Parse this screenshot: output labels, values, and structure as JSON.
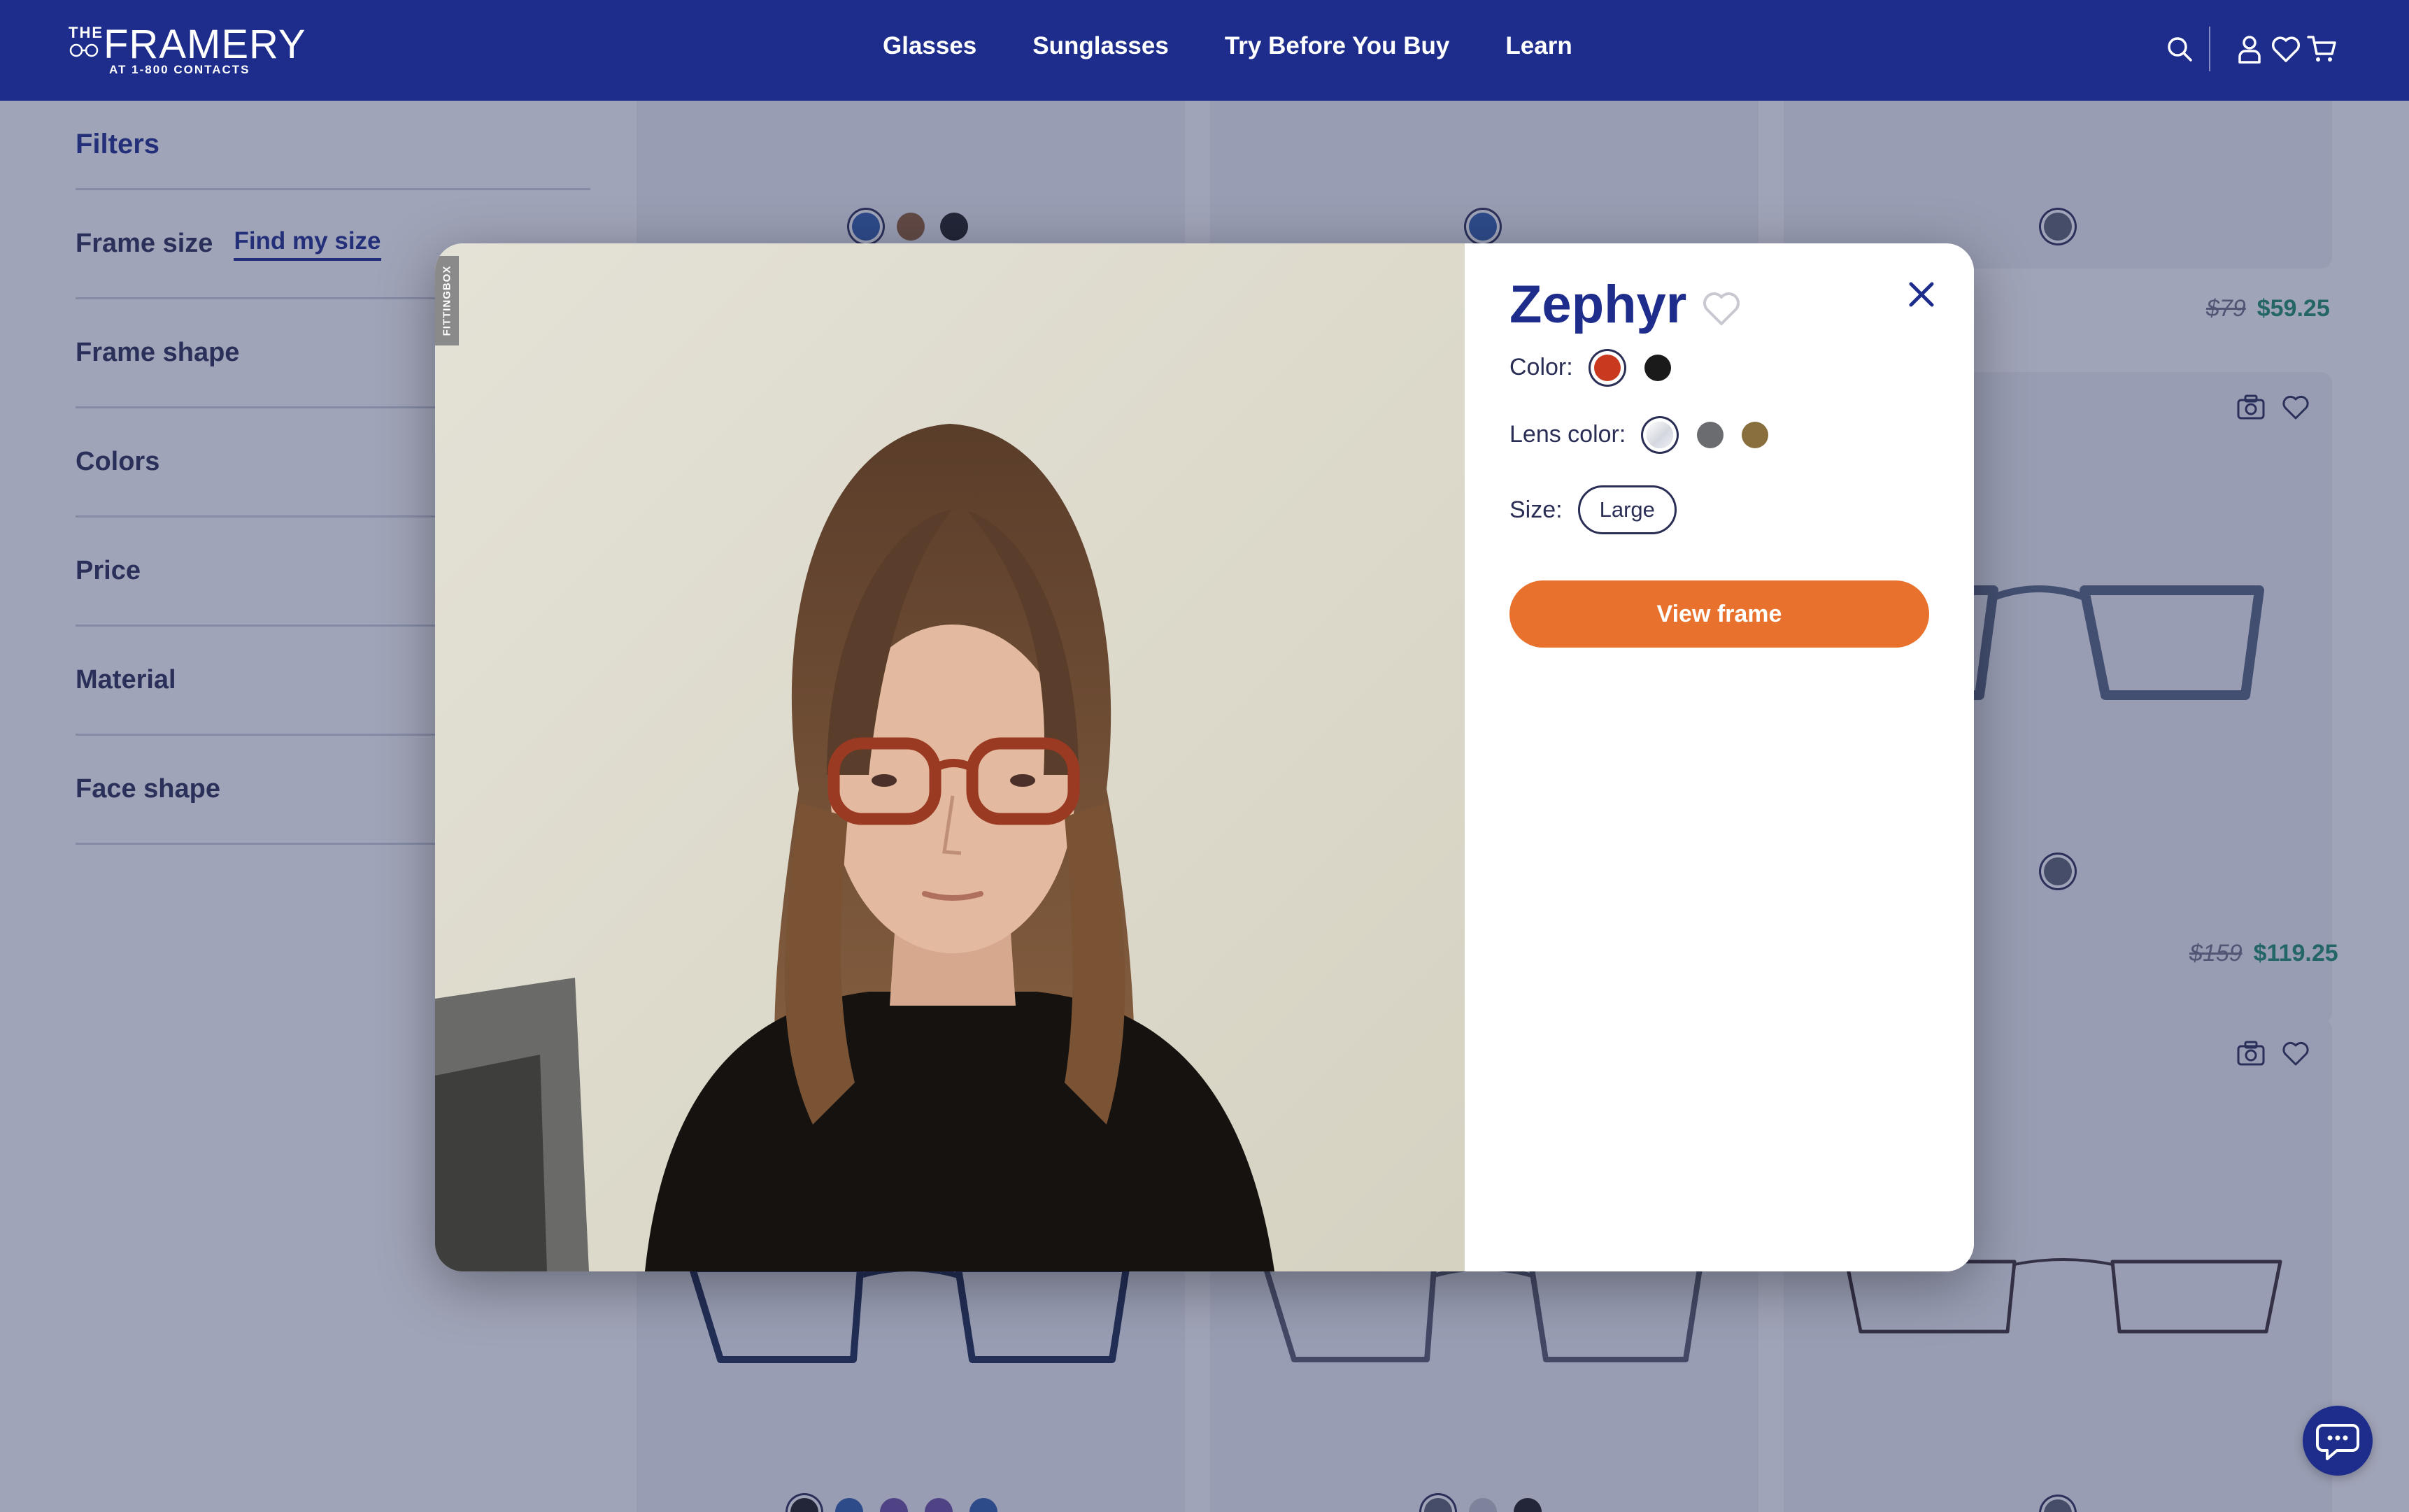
{
  "header": {
    "logo": {
      "top": "THE",
      "brand": "FRAMERY",
      "sub": "AT 1-800 CONTACTS"
    },
    "nav": [
      "Glasses",
      "Sunglasses",
      "Try Before You Buy",
      "Learn"
    ],
    "icons": [
      "search-icon",
      "account-icon",
      "heart-icon",
      "cart-icon"
    ]
  },
  "sidebar": {
    "title": "Filters",
    "frame_size": "Frame size",
    "find_my_size": "Find my size",
    "filters": [
      "Frame shape",
      "Colors",
      "Price",
      "Material",
      "Face shape"
    ]
  },
  "products": {
    "prices": [
      {
        "old": "$79",
        "new": "$59.25"
      },
      {
        "old": "$159",
        "new": "$119.25"
      }
    ],
    "swatch_colors": [
      "#2f5aa8",
      "#8a5a34",
      "#1c1c1c",
      "#5a5f6e"
    ]
  },
  "modal": {
    "frame_name": "Zephyr",
    "color_label": "Color:",
    "colors": [
      {
        "name": "red tortoise",
        "hex": "#c8391f",
        "selected": true
      },
      {
        "name": "black",
        "hex": "#1a1a1a",
        "selected": false
      }
    ],
    "lens_label": "Lens color:",
    "lens_colors": [
      {
        "name": "clear",
        "hex": "#e6e8ee",
        "selected": true
      },
      {
        "name": "gray",
        "hex": "#6a6c70",
        "selected": false
      },
      {
        "name": "brown",
        "hex": "#8a6f3e",
        "selected": false
      }
    ],
    "size_label": "Size:",
    "size": "Large",
    "view_button": "View frame",
    "camera_tag": "FITTINGBOX"
  },
  "colors": {
    "brand": "#1e2d8c",
    "accent": "#e8722d",
    "price_green": "#1f8a6e"
  }
}
